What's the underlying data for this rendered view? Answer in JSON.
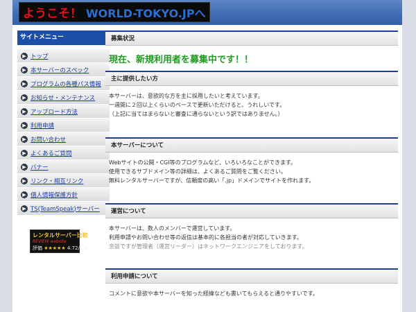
{
  "header": {
    "logo_part1": "ようこそ！",
    "logo_part2": "WORLD-TOKYO.JPへ"
  },
  "sidebar": {
    "title": "サイトメニュー",
    "items": [
      {
        "label": "トップ"
      },
      {
        "label": "本サーバーのスペック"
      },
      {
        "label": "プログラムの各種パス情報"
      },
      {
        "label": "お知らせ・メンテナンス"
      },
      {
        "label": "アップロード方法"
      },
      {
        "label": "利用申請"
      },
      {
        "label": "お問い合わせ"
      },
      {
        "label": "よくあるご質問"
      },
      {
        "label": "バナー"
      },
      {
        "label": "リンク・相互リンク"
      },
      {
        "label": "個人情報保護方針"
      },
      {
        "label": "TS(TeamSpeak)サーバー"
      }
    ],
    "badge": {
      "title": "レンタルサーバー比較",
      "subtitle": "REVIEW website",
      "rating_label": "評価",
      "rating": "4.72",
      "rating_max": "5.0"
    }
  },
  "main": {
    "status": {
      "title": "募集状況",
      "message": "現在、新規利用者を募集中です！！"
    },
    "target": {
      "title": "主に提供したい方",
      "lines": [
        "本サーバーは、意欲的な方を主に採用したいと考えています。",
        "一週間に２回以上くらいのペースで更新いただけると、うれしいです。",
        "（上記に当てはまらないと審査に通らないという訳ではありません。）"
      ]
    },
    "about": {
      "title": "本サーバーについて",
      "lines": [
        "Webサイトの公開・CGI等のプログラムなど、いろいろなことができます。",
        "使用できるサブドメイン等の詳細は、よくあるご質問をご覧ください。",
        "無料レンタルサーバーですが、信頼度の高い「.jp」ドメインでサイトを作れます。"
      ]
    },
    "operation": {
      "title": "運営について",
      "lines": [
        "本サーバーは、数人のメンバーで運営しています。",
        "利用申請やお問い合わせ等の返信は基本的に各担当の者が対応していきます。",
        "余談ですが管理者（運営リーダー）はネットワークエンジニアをしております。"
      ]
    },
    "apply": {
      "title": "利用申請について",
      "lines": [
        "コメントに意欲や本サーバーを知った経緯なども書いてもらえると通りやすいです。"
      ]
    }
  }
}
